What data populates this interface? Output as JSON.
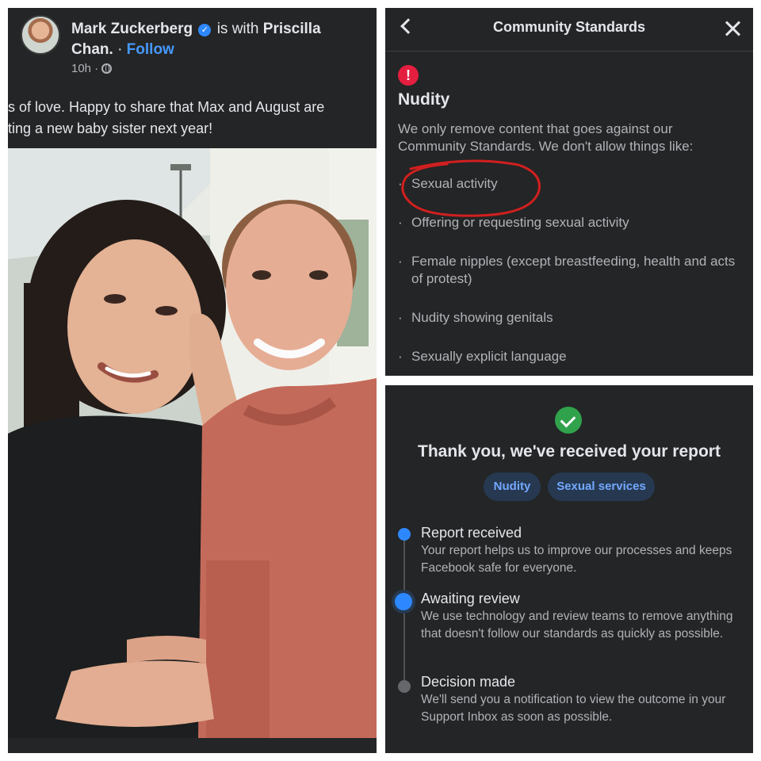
{
  "post": {
    "author": "Mark Zuckerberg",
    "with_text": "is with",
    "tagged": "Priscilla Chan.",
    "follow": "Follow",
    "time": "10h ·",
    "caption_line1": "s of love. Happy to share that Max and August are",
    "caption_line2": "ting a new baby sister next year!",
    "icons": [
      "verified-icon",
      "globe-icon"
    ]
  },
  "community_standards": {
    "title": "Community Standards",
    "heading": "Nudity",
    "description": "We only remove content that goes against our Community Standards. We don't allow things like:",
    "bullet": "·",
    "rules": [
      "Sexual activity",
      "Offering or requesting sexual activity",
      "Female nipples (except breastfeeding, health and acts of protest)",
      "Nudity showing genitals",
      "Sexually explicit language"
    ],
    "annotation_color": "#d11f1f",
    "icons": [
      "back-icon",
      "close-icon",
      "alert-icon"
    ]
  },
  "report": {
    "title": "Thank you, we've received your report",
    "tags": [
      "Nudity",
      "Sexual services"
    ],
    "steps": [
      {
        "title": "Report received",
        "description": "Your report helps us to improve our processes and keeps Facebook safe for everyone.",
        "state": "done"
      },
      {
        "title": "Awaiting review",
        "description": "We use technology and review teams to remove anything that doesn't follow our standards as quickly as possible.",
        "state": "current"
      },
      {
        "title": "Decision made",
        "description": "We'll send you a notification to view the outcome in your Support Inbox as soon as possible.",
        "state": "pending"
      }
    ],
    "colors": {
      "accent": "#2d88ff",
      "success": "#31a24c",
      "chip_bg": "#263951",
      "chip_text": "#73a8ff"
    }
  }
}
